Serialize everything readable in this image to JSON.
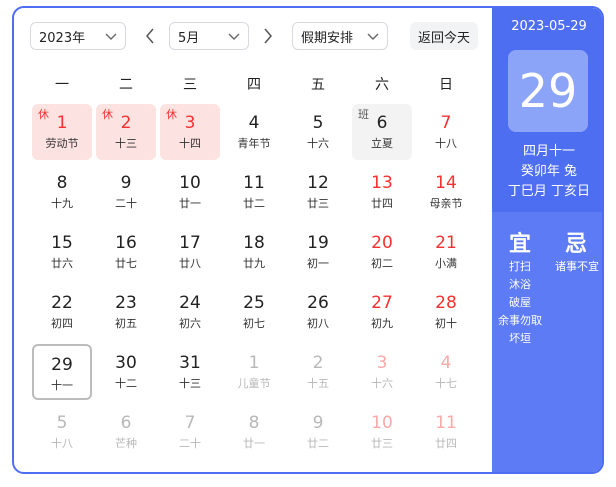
{
  "header": {
    "year_select": "2023年",
    "month_select": "5月",
    "holiday_select": "假期安排",
    "today_button": "返回今天"
  },
  "weekdays": [
    "一",
    "二",
    "三",
    "四",
    "五",
    "六",
    "日"
  ],
  "weeks": [
    [
      {
        "num": "1",
        "lunar": "劳动节",
        "type": "holiday",
        "mark": "休"
      },
      {
        "num": "2",
        "lunar": "十三",
        "type": "holiday",
        "mark": "休"
      },
      {
        "num": "3",
        "lunar": "十四",
        "type": "holiday",
        "mark": "休"
      },
      {
        "num": "4",
        "lunar": "青年节",
        "type": "normal"
      },
      {
        "num": "5",
        "lunar": "十六",
        "type": "normal"
      },
      {
        "num": "6",
        "lunar": "立夏",
        "type": "work",
        "mark": "班"
      },
      {
        "num": "7",
        "lunar": "十八",
        "type": "weekend"
      }
    ],
    [
      {
        "num": "8",
        "lunar": "十九",
        "type": "normal"
      },
      {
        "num": "9",
        "lunar": "二十",
        "type": "normal"
      },
      {
        "num": "10",
        "lunar": "廿一",
        "type": "normal"
      },
      {
        "num": "11",
        "lunar": "廿二",
        "type": "normal"
      },
      {
        "num": "12",
        "lunar": "廿三",
        "type": "normal"
      },
      {
        "num": "13",
        "lunar": "廿四",
        "type": "weekend"
      },
      {
        "num": "14",
        "lunar": "母亲节",
        "type": "weekend"
      }
    ],
    [
      {
        "num": "15",
        "lunar": "廿六",
        "type": "normal"
      },
      {
        "num": "16",
        "lunar": "廿七",
        "type": "normal"
      },
      {
        "num": "17",
        "lunar": "廿八",
        "type": "normal"
      },
      {
        "num": "18",
        "lunar": "廿九",
        "type": "normal"
      },
      {
        "num": "19",
        "lunar": "初一",
        "type": "normal"
      },
      {
        "num": "20",
        "lunar": "初二",
        "type": "weekend"
      },
      {
        "num": "21",
        "lunar": "小满",
        "type": "weekend"
      }
    ],
    [
      {
        "num": "22",
        "lunar": "初四",
        "type": "normal"
      },
      {
        "num": "23",
        "lunar": "初五",
        "type": "normal"
      },
      {
        "num": "24",
        "lunar": "初六",
        "type": "normal"
      },
      {
        "num": "25",
        "lunar": "初七",
        "type": "normal"
      },
      {
        "num": "26",
        "lunar": "初八",
        "type": "normal"
      },
      {
        "num": "27",
        "lunar": "初九",
        "type": "weekend"
      },
      {
        "num": "28",
        "lunar": "初十",
        "type": "weekend"
      }
    ],
    [
      {
        "num": "29",
        "lunar": "十一",
        "type": "today"
      },
      {
        "num": "30",
        "lunar": "十二",
        "type": "normal"
      },
      {
        "num": "31",
        "lunar": "十三",
        "type": "normal"
      },
      {
        "num": "1",
        "lunar": "儿童节",
        "type": "other"
      },
      {
        "num": "2",
        "lunar": "十五",
        "type": "other"
      },
      {
        "num": "3",
        "lunar": "十六",
        "type": "other-weekend"
      },
      {
        "num": "4",
        "lunar": "十七",
        "type": "other-weekend"
      }
    ],
    [
      {
        "num": "5",
        "lunar": "十八",
        "type": "other"
      },
      {
        "num": "6",
        "lunar": "芒种",
        "type": "other"
      },
      {
        "num": "7",
        "lunar": "二十",
        "type": "other"
      },
      {
        "num": "8",
        "lunar": "廿一",
        "type": "other"
      },
      {
        "num": "9",
        "lunar": "廿二",
        "type": "other"
      },
      {
        "num": "10",
        "lunar": "廿三",
        "type": "other-weekend"
      },
      {
        "num": "11",
        "lunar": "廿四",
        "type": "other-weekend"
      }
    ]
  ],
  "side": {
    "date": "2023-05-29",
    "day": "29",
    "lunar_date": "四月十一",
    "year_ganzhi": "癸卯年 兔",
    "month_day_ganzhi": "丁巳月 丁亥日",
    "yi_title": "宜",
    "ji_title": "忌",
    "yi_items": [
      "打扫",
      "沐浴",
      "破屋",
      "余事勿取",
      "坏垣"
    ],
    "ji_items": [
      "诸事不宜"
    ]
  },
  "colors": {
    "accent": "#4e6ef2",
    "holiday_red": "#f73131",
    "holiday_bg": "#fde2e2"
  }
}
